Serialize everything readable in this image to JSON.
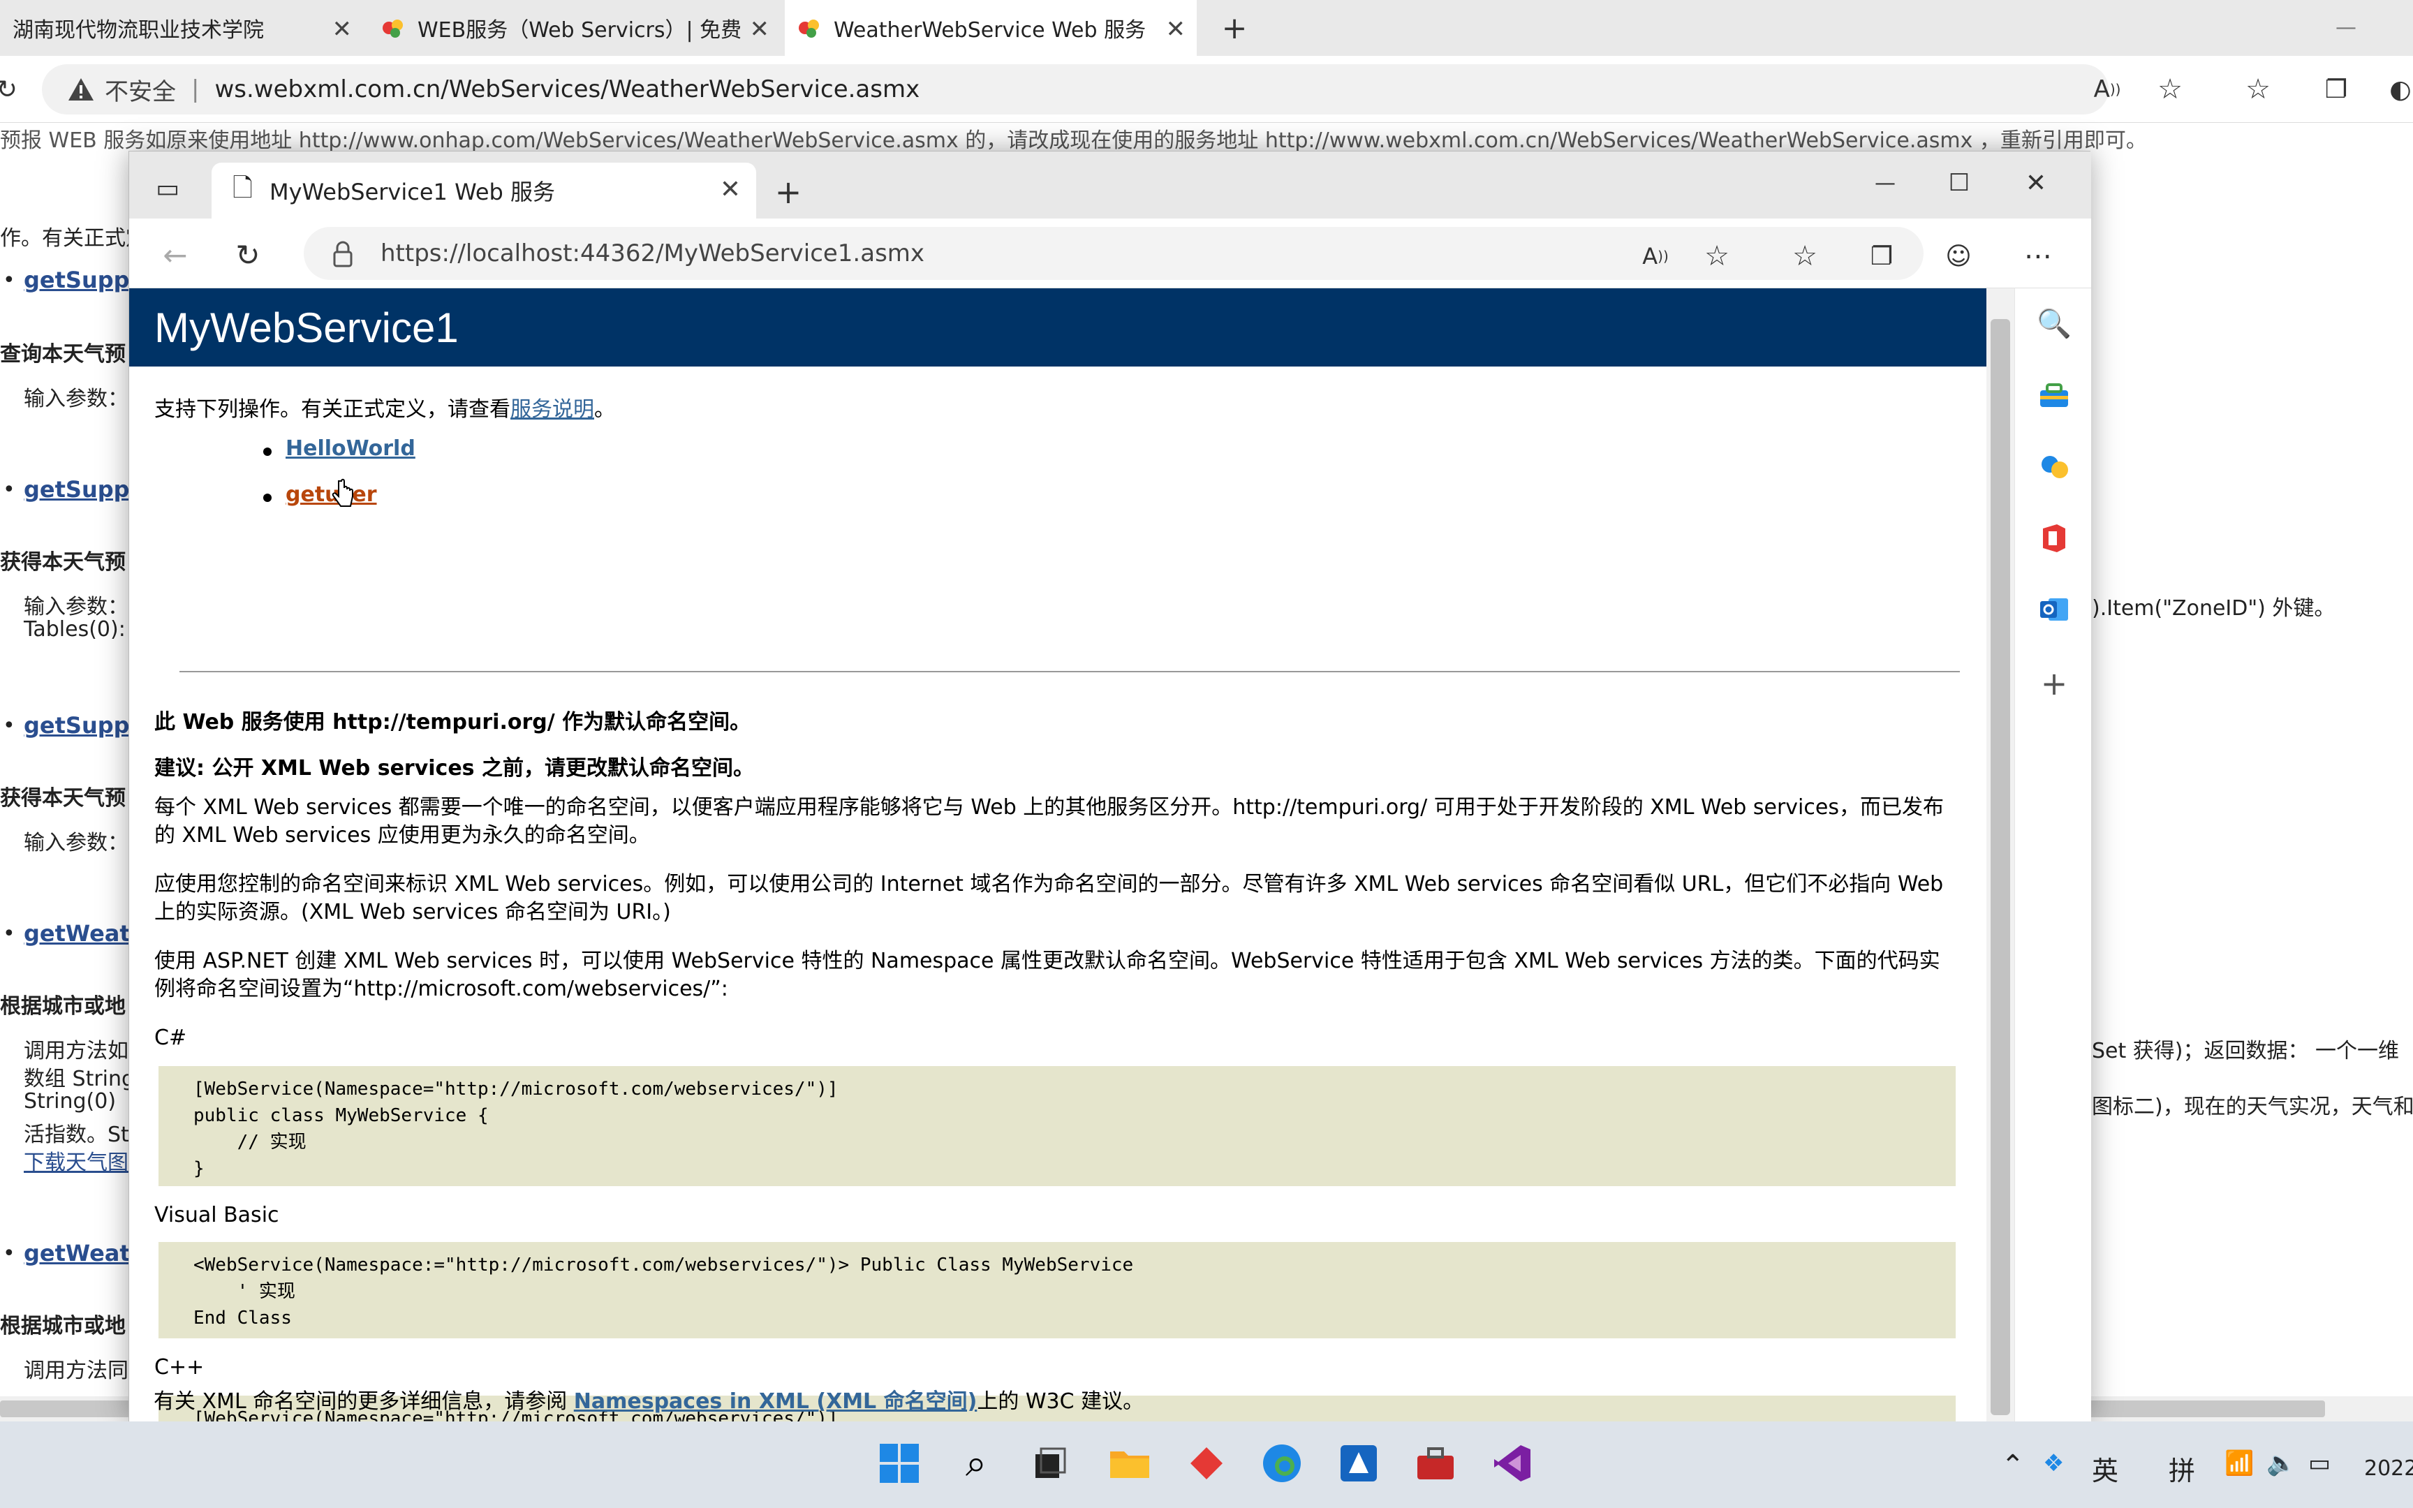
{
  "bg_browser": {
    "tabs": [
      {
        "title": "湖南现代物流职业技术学院"
      },
      {
        "title": "WEB服务（Web Servicrs）| 免费"
      },
      {
        "title": "WeatherWebService Web 服务"
      }
    ],
    "address": {
      "security": "不安全",
      "url": "ws.webxml.com.cn/WebServices/WeatherWebService.asmx"
    },
    "page": {
      "notice": "预报 WEB 服务如原来使用地址 http://www.onhap.com/WebServices/WeatherWebService.asmx 的，请改成现在使用的服务地址 http://www.webxml.com.cn/WebServices/WeatherWebService.asmx ，重新引用即可。",
      "intro_fragment": "作。有关正式定",
      "links": [
        "getSuppo",
        "getSuppo",
        "getSuppo",
        "getWeat",
        "getWeat"
      ],
      "headings": [
        "查询本天气预",
        "获得本天气预",
        "获得本天气预",
        "根据城市或地",
        "根据城市或地"
      ],
      "params": [
        "输入参数：",
        "输入参数：",
        "Tables(0):",
        "输入参数："
      ],
      "method_lines": [
        "调用方法如",
        "数组 String",
        "String(0)",
        "活指数。St"
      ],
      "download_link": "下载天气图",
      "last_line": "调用方法同",
      "right_frag1": ").Item(\"ZoneID\") 外键。",
      "right_frag2": "Set 获得)；返回数据： 一个一维",
      "right_frag3": "图标二)，现在的天气实况，天气和生"
    }
  },
  "fg_browser": {
    "tab_title": "MyWebService1 Web 服务",
    "url": "https://localhost:44362/MyWebService1.asmx"
  },
  "service": {
    "title": "MyWebService1",
    "intro": "支持下列操作。有关正式定义，请查看",
    "intro_link": "服务说明",
    "intro_end": "。",
    "operations": [
      "HelloWorld",
      "getuser"
    ],
    "ns_default": "此 Web 服务使用 http://tempuri.org/ 作为默认命名空间。",
    "recommend": "建议: 公开 XML Web services 之前，请更改默认命名空间。",
    "para1": "每个 XML Web services 都需要一个唯一的命名空间，以便客户端应用程序能够将它与 Web 上的其他服务区分开。http://tempuri.org/ 可用于处于开发阶段的 XML Web services，而已发布的 XML Web services 应使用更为永久的命名空间。",
    "para2": "应使用您控制的命名空间来标识 XML Web services。例如，可以使用公司的 Internet 域名作为命名空间的一部分。尽管有许多 XML Web services 命名空间看似 URL，但它们不必指向 Web 上的实际资源。(XML Web services 命名空间为 URI。)",
    "para3": "使用 ASP.NET 创建 XML Web services 时，可以使用 WebService 特性的 Namespace 属性更改默认命名空间。WebService 特性适用于包含 XML Web services 方法的类。下面的代码实例将命名空间设置为“http://microsoft.com/webservices/”:",
    "lang_cs": "C#",
    "code_cs": "[WebService(Namespace=\"http://microsoft.com/webservices/\")]\npublic class MyWebService {\n    // 实现\n}",
    "lang_vb": "Visual Basic",
    "code_vb": "<WebService(Namespace:=\"http://microsoft.com/webservices/\")> Public Class MyWebService\n    ' 实现\nEnd Class",
    "lang_cpp": "C++",
    "code_cpp": "[WebService(Namespace=\"http://microsoft.com/webservices/\")]\npublic ref class MyWebService {\n    // 实现\n};",
    "footer_pre": "有关 XML 命名空间的更多详细信息，请参阅 ",
    "footer_link": "Namespaces in XML (XML 命名空间)",
    "footer_post": "上的 W3C 建议。"
  },
  "taskbar": {
    "tray_ime1": "英",
    "tray_ime2": "拼",
    "clock_year": "2022"
  }
}
